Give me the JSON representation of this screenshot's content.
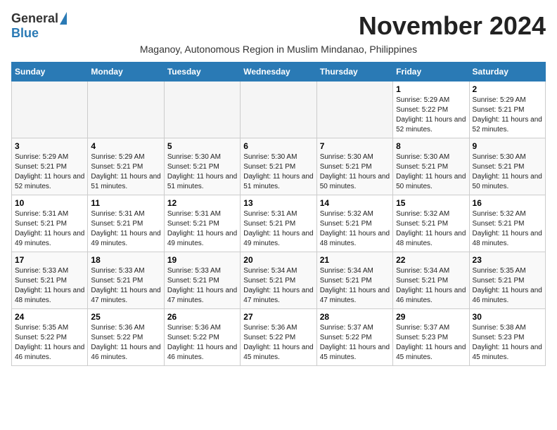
{
  "logo": {
    "general": "General",
    "blue": "Blue"
  },
  "title": "November 2024",
  "subtitle": "Maganoy, Autonomous Region in Muslim Mindanao, Philippines",
  "headers": [
    "Sunday",
    "Monday",
    "Tuesday",
    "Wednesday",
    "Thursday",
    "Friday",
    "Saturday"
  ],
  "weeks": [
    [
      {
        "day": "",
        "info": ""
      },
      {
        "day": "",
        "info": ""
      },
      {
        "day": "",
        "info": ""
      },
      {
        "day": "",
        "info": ""
      },
      {
        "day": "",
        "info": ""
      },
      {
        "day": "1",
        "info": "Sunrise: 5:29 AM\nSunset: 5:22 PM\nDaylight: 11 hours and 52 minutes."
      },
      {
        "day": "2",
        "info": "Sunrise: 5:29 AM\nSunset: 5:21 PM\nDaylight: 11 hours and 52 minutes."
      }
    ],
    [
      {
        "day": "3",
        "info": "Sunrise: 5:29 AM\nSunset: 5:21 PM\nDaylight: 11 hours and 52 minutes."
      },
      {
        "day": "4",
        "info": "Sunrise: 5:29 AM\nSunset: 5:21 PM\nDaylight: 11 hours and 51 minutes."
      },
      {
        "day": "5",
        "info": "Sunrise: 5:30 AM\nSunset: 5:21 PM\nDaylight: 11 hours and 51 minutes."
      },
      {
        "day": "6",
        "info": "Sunrise: 5:30 AM\nSunset: 5:21 PM\nDaylight: 11 hours and 51 minutes."
      },
      {
        "day": "7",
        "info": "Sunrise: 5:30 AM\nSunset: 5:21 PM\nDaylight: 11 hours and 50 minutes."
      },
      {
        "day": "8",
        "info": "Sunrise: 5:30 AM\nSunset: 5:21 PM\nDaylight: 11 hours and 50 minutes."
      },
      {
        "day": "9",
        "info": "Sunrise: 5:30 AM\nSunset: 5:21 PM\nDaylight: 11 hours and 50 minutes."
      }
    ],
    [
      {
        "day": "10",
        "info": "Sunrise: 5:31 AM\nSunset: 5:21 PM\nDaylight: 11 hours and 49 minutes."
      },
      {
        "day": "11",
        "info": "Sunrise: 5:31 AM\nSunset: 5:21 PM\nDaylight: 11 hours and 49 minutes."
      },
      {
        "day": "12",
        "info": "Sunrise: 5:31 AM\nSunset: 5:21 PM\nDaylight: 11 hours and 49 minutes."
      },
      {
        "day": "13",
        "info": "Sunrise: 5:31 AM\nSunset: 5:21 PM\nDaylight: 11 hours and 49 minutes."
      },
      {
        "day": "14",
        "info": "Sunrise: 5:32 AM\nSunset: 5:21 PM\nDaylight: 11 hours and 48 minutes."
      },
      {
        "day": "15",
        "info": "Sunrise: 5:32 AM\nSunset: 5:21 PM\nDaylight: 11 hours and 48 minutes."
      },
      {
        "day": "16",
        "info": "Sunrise: 5:32 AM\nSunset: 5:21 PM\nDaylight: 11 hours and 48 minutes."
      }
    ],
    [
      {
        "day": "17",
        "info": "Sunrise: 5:33 AM\nSunset: 5:21 PM\nDaylight: 11 hours and 48 minutes."
      },
      {
        "day": "18",
        "info": "Sunrise: 5:33 AM\nSunset: 5:21 PM\nDaylight: 11 hours and 47 minutes."
      },
      {
        "day": "19",
        "info": "Sunrise: 5:33 AM\nSunset: 5:21 PM\nDaylight: 11 hours and 47 minutes."
      },
      {
        "day": "20",
        "info": "Sunrise: 5:34 AM\nSunset: 5:21 PM\nDaylight: 11 hours and 47 minutes."
      },
      {
        "day": "21",
        "info": "Sunrise: 5:34 AM\nSunset: 5:21 PM\nDaylight: 11 hours and 47 minutes."
      },
      {
        "day": "22",
        "info": "Sunrise: 5:34 AM\nSunset: 5:21 PM\nDaylight: 11 hours and 46 minutes."
      },
      {
        "day": "23",
        "info": "Sunrise: 5:35 AM\nSunset: 5:21 PM\nDaylight: 11 hours and 46 minutes."
      }
    ],
    [
      {
        "day": "24",
        "info": "Sunrise: 5:35 AM\nSunset: 5:22 PM\nDaylight: 11 hours and 46 minutes."
      },
      {
        "day": "25",
        "info": "Sunrise: 5:36 AM\nSunset: 5:22 PM\nDaylight: 11 hours and 46 minutes."
      },
      {
        "day": "26",
        "info": "Sunrise: 5:36 AM\nSunset: 5:22 PM\nDaylight: 11 hours and 46 minutes."
      },
      {
        "day": "27",
        "info": "Sunrise: 5:36 AM\nSunset: 5:22 PM\nDaylight: 11 hours and 45 minutes."
      },
      {
        "day": "28",
        "info": "Sunrise: 5:37 AM\nSunset: 5:22 PM\nDaylight: 11 hours and 45 minutes."
      },
      {
        "day": "29",
        "info": "Sunrise: 5:37 AM\nSunset: 5:23 PM\nDaylight: 11 hours and 45 minutes."
      },
      {
        "day": "30",
        "info": "Sunrise: 5:38 AM\nSunset: 5:23 PM\nDaylight: 11 hours and 45 minutes."
      }
    ]
  ]
}
